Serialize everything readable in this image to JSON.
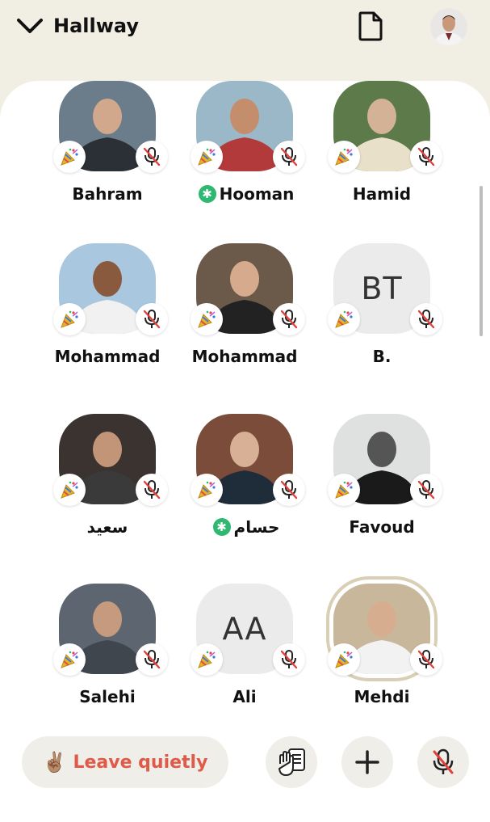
{
  "header": {
    "title": "Hallway",
    "back_icon": "chevron-down-icon",
    "doc_icon": "document-icon"
  },
  "participants": [
    {
      "name": "Bahram",
      "moderator": false
    },
    {
      "name": "Hooman",
      "moderator": true
    },
    {
      "name": "Hamid",
      "moderator": false
    },
    {
      "name": "Mohammad",
      "moderator": false
    },
    {
      "name": "Mohammad",
      "moderator": false
    },
    {
      "name": "B.",
      "initials": "BT",
      "moderator": false
    },
    {
      "name": "سعید",
      "moderator": false
    },
    {
      "name": "حسام",
      "moderator": true
    },
    {
      "name": "Favoud",
      "moderator": false
    },
    {
      "name": "Salehi",
      "moderator": false
    },
    {
      "name": "Ali",
      "initials": "AA",
      "moderator": false
    },
    {
      "name": "Mehdi",
      "moderator": false,
      "speaking": true
    }
  ],
  "controls": {
    "leave_emoji": "✌🏽",
    "leave_label": "Leave quietly",
    "add_icon": "plus-icon",
    "raise_hand_icon": "raise-hand-icon",
    "mute_icon": "mic-off-icon"
  },
  "colors": {
    "background": "#f1efe4",
    "sheet": "#ffffff",
    "leave_text": "#e05a47",
    "moderator_badge": "#2eb872",
    "mute_red": "#e0413a"
  }
}
